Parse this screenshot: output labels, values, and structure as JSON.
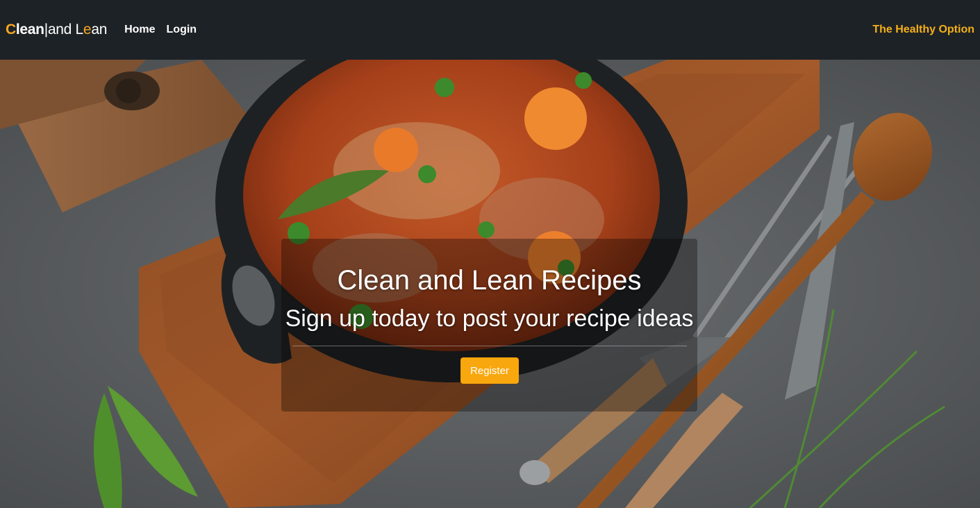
{
  "navbar": {
    "brand": {
      "part1_accent": "C",
      "part1_rest": "lean",
      "separator": "|",
      "part2_start": "and L",
      "part2_accent": "e",
      "part2_end": "an"
    },
    "links": [
      "Home",
      "Login"
    ],
    "tagline": "The Healthy Option"
  },
  "hero": {
    "title": "Clean and Lean Recipes",
    "subtitle": "Sign up today to post your recipe ideas",
    "register_label": "Register"
  },
  "colors": {
    "navbar_bg": "#1d2226",
    "accent": "#f5a623",
    "tagline": "#f5b01a",
    "button": "#f9a70e"
  }
}
